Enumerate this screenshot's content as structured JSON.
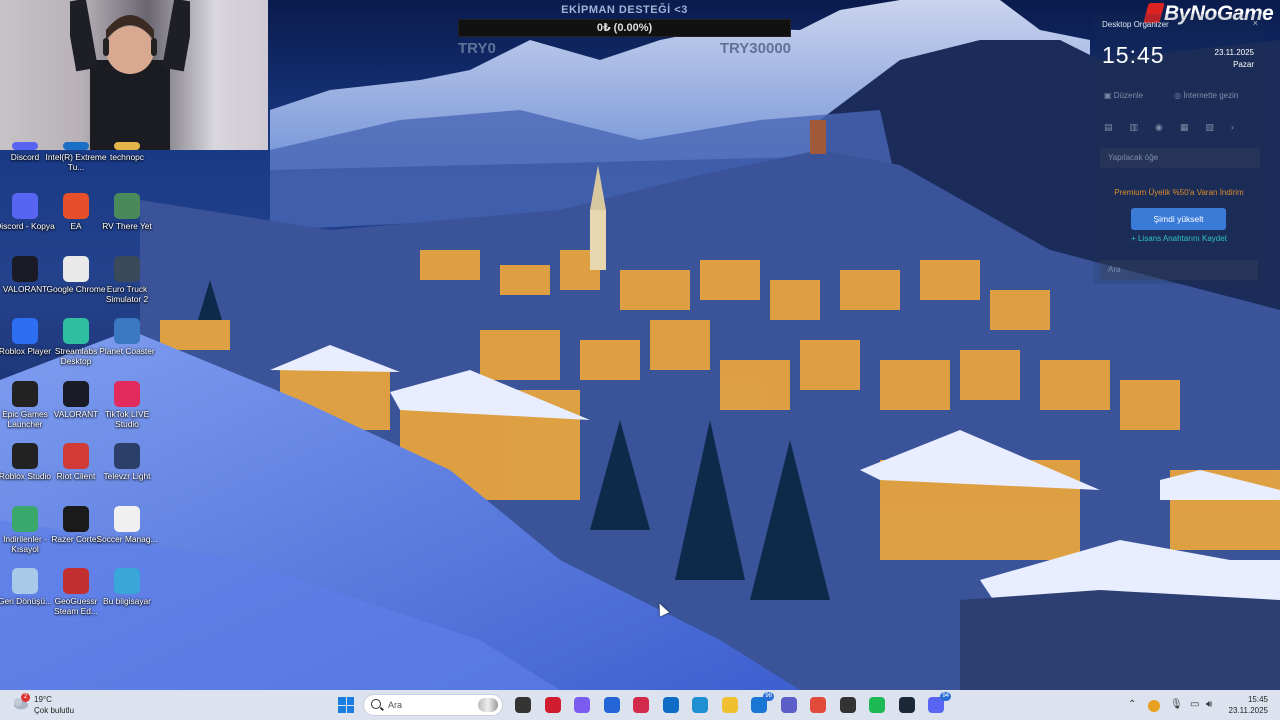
{
  "donation": {
    "title": "EKİPMAN DESTEĞİ <3",
    "progress_text": "0₺ (0.00%)",
    "progress_fraction": 0.0,
    "min_label": "TRY0",
    "max_label": "TRY30000"
  },
  "brand": {
    "name": "ByNoGame"
  },
  "organizer": {
    "title": "Desktop Organizer",
    "time": "15:45",
    "date": "23.11.2025",
    "day": "Pazar",
    "edit_label": "Düzenle",
    "web_label": "İnternette gezin",
    "todo_placeholder": "Yapılacak öğe",
    "premium_text": "Premium Üyelik %50'a Varan İndirim",
    "upgrade_label": "Şimdi yükselt",
    "license_text": "+ Lisans Anahtarını Kaydet",
    "search_placeholder": "Ara"
  },
  "desktop_icons": [
    {
      "label": "Discord",
      "icon": "discord-icon",
      "color": "#5865f2"
    },
    {
      "label": "Intel(R) Extreme Tu...",
      "icon": "intel-icon",
      "color": "#1a6fc4"
    },
    {
      "label": "technopc",
      "icon": "folder-icon",
      "color": "#e4b64a"
    },
    {
      "label": "Discord - Kopya",
      "icon": "discord-icon",
      "color": "#5865f2"
    },
    {
      "label": "EA",
      "icon": "ea-icon",
      "color": "#e5502a"
    },
    {
      "label": "RV There Yet",
      "icon": "rv-game-icon",
      "color": "#4a8a5a"
    },
    {
      "label": "VALORANT",
      "icon": "valorant-icon",
      "color": "#1b1b26"
    },
    {
      "label": "Google Chrome",
      "icon": "chrome-icon",
      "color": "#e9e9e9"
    },
    {
      "label": "Euro Truck Simulator 2",
      "icon": "truck-icon",
      "color": "#3b4a5a"
    },
    {
      "label": "Roblox Player",
      "icon": "roblox-icon",
      "color": "#2d6ef2"
    },
    {
      "label": "Streamlabs Desktop",
      "icon": "streamlabs-icon",
      "color": "#2fbfa0"
    },
    {
      "label": "Planet Coaster",
      "icon": "planet-coaster-icon",
      "color": "#3a78c2"
    },
    {
      "label": "Epic Games Launcher",
      "icon": "epic-games-icon",
      "color": "#222222"
    },
    {
      "label": "VALORANT",
      "icon": "valorant-icon",
      "color": "#1b1b26"
    },
    {
      "label": "TikTok LIVE Studio",
      "icon": "tiktok-icon",
      "color": "#e22a5c"
    },
    {
      "label": "Roblox Studio",
      "icon": "roblox-studio-icon",
      "color": "#222222"
    },
    {
      "label": "Riot Client",
      "icon": "riot-icon",
      "color": "#d13a35"
    },
    {
      "label": "Televzr Light",
      "icon": "televzr-icon",
      "color": "#2c3f6a"
    },
    {
      "label": "İndirilenler - Kısayol",
      "icon": "download-folder-icon",
      "color": "#3aa86a"
    },
    {
      "label": "Razer Cortex",
      "icon": "razer-icon",
      "color": "#1a1a1a"
    },
    {
      "label": "Soccer Manag...",
      "icon": "soccer-manager-icon",
      "color": "#f0f0f0"
    },
    {
      "label": "Geri Dönüşü...",
      "icon": "recycle-bin-icon",
      "color": "#a9c9e8"
    },
    {
      "label": "GeoGuessr Steam Ed...",
      "icon": "geoguessr-icon",
      "color": "#c43030"
    },
    {
      "label": "Bu bilgisayar",
      "icon": "computer-icon",
      "color": "#38a6d8"
    }
  ],
  "taskbar": {
    "weather_temp": "19°C",
    "weather_desc": "Çok bulutlu",
    "weather_badge": "2",
    "search_placeholder": "Ara",
    "apps": [
      {
        "name": "task-view-icon",
        "color": "#333333"
      },
      {
        "name": "opera-gx-icon",
        "color": "#d11b2f"
      },
      {
        "name": "copilot-icon",
        "color": "#7a5cf0"
      },
      {
        "name": "store-icon",
        "color": "#2466d8"
      },
      {
        "name": "opera-icon",
        "color": "#d12a4a"
      },
      {
        "name": "outlook-icon",
        "color": "#0f6cc4"
      },
      {
        "name": "edge-icon",
        "color": "#1e8fd0"
      },
      {
        "name": "file-explorer-icon",
        "color": "#f0c030"
      },
      {
        "name": "mail-icon",
        "color": "#1976d2",
        "badge": "98"
      },
      {
        "name": "teams-icon",
        "color": "#5b5fc7"
      },
      {
        "name": "chrome-icon",
        "color": "#e24a3a"
      },
      {
        "name": "app-icon",
        "color": "#333333"
      },
      {
        "name": "spotify-icon",
        "color": "#1db954"
      },
      {
        "name": "steam-icon",
        "color": "#1b2838"
      },
      {
        "name": "discord-icon",
        "color": "#5865f2",
        "badge": "94"
      }
    ],
    "clock_time": "15:45",
    "clock_date": "23.11.2025"
  }
}
